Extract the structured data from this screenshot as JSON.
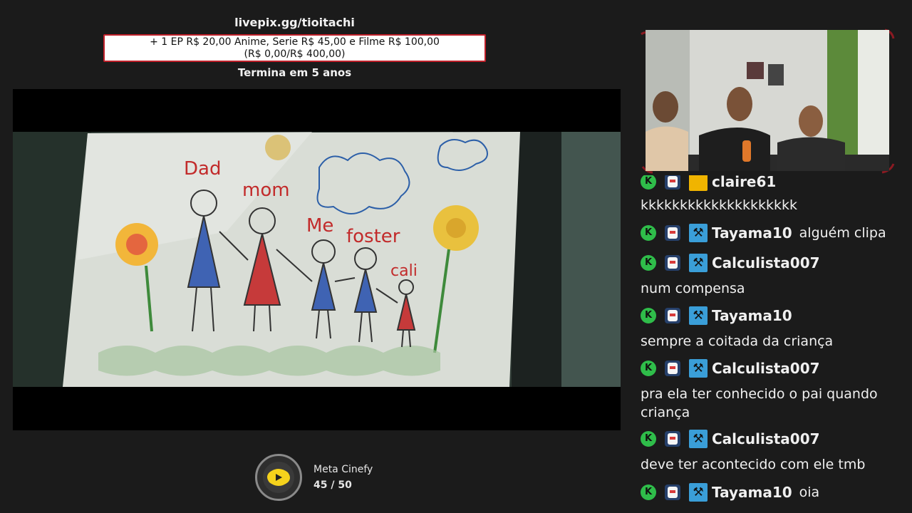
{
  "goal": {
    "url": "livepix.gg/tioitachi",
    "line1": "+ 1 EP R$ 20,00 Anime, Serie R$ 45,00 e Filme R$ 100,00",
    "line2": "(R$ 0,00/R$ 400,00)",
    "ends": "Termina em 5 anos"
  },
  "video": {
    "drawing_labels": [
      "Dad",
      "mom",
      "Me",
      "foster",
      "cali"
    ]
  },
  "meta": {
    "title": "Meta Cinefy",
    "progress": "45 / 50",
    "current": 45,
    "target": 50
  },
  "chat": {
    "partial_user": "claire61",
    "messages": [
      {
        "text": "kkkkkkkkkkkkkkkkkkkk"
      },
      {
        "user": "Tayama10",
        "text": "alguém clipa"
      },
      {
        "user": "Calculista007",
        "text": "num compensa"
      },
      {
        "user": "Tayama10",
        "text": "sempre a coitada da criança"
      },
      {
        "user": "Calculista007",
        "text": "pra ela ter conhecido o pai quando criança"
      },
      {
        "user": "Calculista007",
        "text": "deve ter acontecido com ele tmb"
      },
      {
        "user": "Tayama10",
        "text": "oia"
      }
    ]
  },
  "colors": {
    "background": "#1b1b1b",
    "goal_border": "#c0202a",
    "k_badge": "#2fbd4a",
    "mod_badge": "#3a9ed8",
    "meta_icon": "#f5d21c"
  }
}
